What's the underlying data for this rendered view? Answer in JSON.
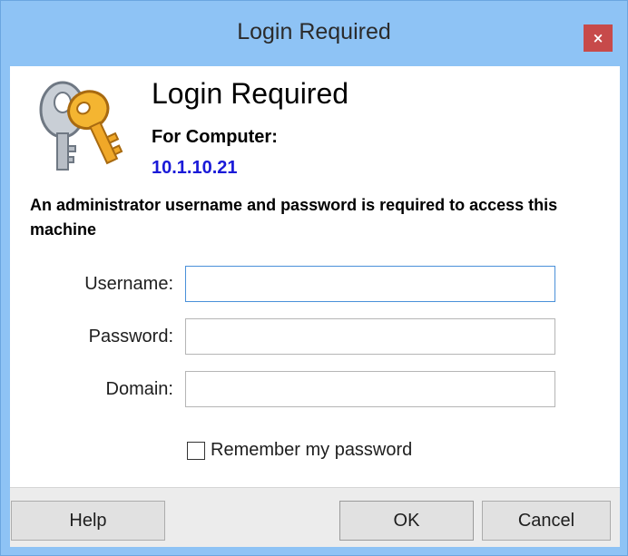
{
  "window": {
    "title": "Login Required",
    "close_glyph": "×"
  },
  "header": {
    "icon": "keys-icon",
    "heading": "Login Required",
    "for_computer_label": "For Computer:",
    "computer_address": "10.1.10.21"
  },
  "message": "An administrator username and password is required to access this machine",
  "form": {
    "username": {
      "label": "Username:",
      "value": ""
    },
    "password": {
      "label": "Password:",
      "value": ""
    },
    "domain": {
      "label": "Domain:",
      "value": ""
    },
    "remember": {
      "label": "Remember my password",
      "checked": false
    }
  },
  "buttons": {
    "help": "Help",
    "ok": "OK",
    "cancel": "Cancel"
  },
  "colors": {
    "frame": "#8ec3f5",
    "close_button": "#c74a4a",
    "address_text": "#1a1ad8",
    "focus_border": "#4a90d9"
  }
}
